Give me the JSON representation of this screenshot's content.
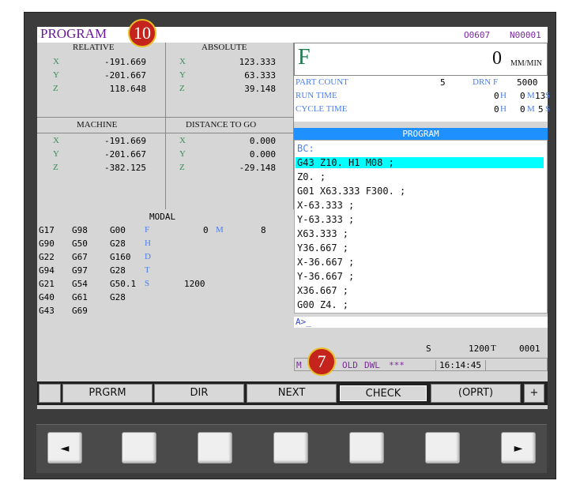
{
  "header": {
    "title": "PROGRAM",
    "program_no": "O0607",
    "sequence_no": "N00001"
  },
  "badges": {
    "top": "10",
    "bottom": "7"
  },
  "relative": {
    "title": "RELATIVE",
    "rows": [
      {
        "axis": "X",
        "value": "-191.669"
      },
      {
        "axis": "Y",
        "value": "-201.667"
      },
      {
        "axis": "Z",
        "value": "118.648"
      }
    ]
  },
  "absolute": {
    "title": "ABSOLUTE",
    "rows": [
      {
        "axis": "X",
        "value": "123.333"
      },
      {
        "axis": "Y",
        "value": "63.333"
      },
      {
        "axis": "Z",
        "value": "39.148"
      }
    ]
  },
  "machine": {
    "title": "MACHINE",
    "rows": [
      {
        "axis": "X",
        "value": "-191.669"
      },
      {
        "axis": "Y",
        "value": "-201.667"
      },
      {
        "axis": "Z",
        "value": "-382.125"
      }
    ]
  },
  "distance": {
    "title": "DISTANCE TO GO",
    "rows": [
      {
        "axis": "X",
        "value": "0.000"
      },
      {
        "axis": "Y",
        "value": "0.000"
      },
      {
        "axis": "Z",
        "value": "-29.148"
      }
    ]
  },
  "modal": {
    "title": "MODAL",
    "rows": [
      [
        "G17",
        "G98",
        "G00"
      ],
      [
        "G90",
        "G50",
        "G28"
      ],
      [
        "G22",
        "G67",
        "G160"
      ],
      [
        "G94",
        "G97",
        "G28"
      ],
      [
        "G21",
        "G54",
        "G50.1"
      ],
      [
        "G40",
        "G61",
        "G28"
      ],
      [
        "G43",
        "G69",
        ""
      ]
    ],
    "f_label": "F",
    "f_value": "0",
    "m_label": "M",
    "m_value": "8",
    "h_label": "H",
    "d_label": "D",
    "t_label": "T",
    "s_label": "S",
    "s_value": "1200"
  },
  "feed": {
    "label": "F",
    "value": "0",
    "unit": "MM/MIN"
  },
  "status": {
    "part_count_label": "PART COUNT",
    "part_count": "5",
    "drnf_label": "DRN F",
    "drnf_value": "5000",
    "run_time_label": "RUN TIME",
    "run_h": "0",
    "run_m": "0",
    "run_s": "13",
    "cycle_time_label": "CYCLE TIME",
    "cycle_h": "0",
    "cycle_m": "0",
    "cycle_s": "5",
    "h_unit": "H",
    "m_unit": "M",
    "s_unit": "S"
  },
  "program": {
    "title": "PROGRAM",
    "lines": [
      "BC:",
      "G43 Z10. H1 M08 ;",
      "Z0. ;",
      "G01 X63.333 F300. ;",
      "X-63.333 ;",
      "Y-63.333 ;",
      "X63.333 ;",
      "Y36.667 ;",
      "X-36.667 ;",
      "Y-36.667 ;",
      "X36.667 ;",
      "G00 Z4. ;"
    ]
  },
  "input_prompt": "A>_",
  "bottom_status": {
    "s_label": "S",
    "s_value": "1200",
    "t_label": "T",
    "t_value": "0001",
    "mode_prefix": "M",
    "mode": "OLD",
    "dwl": "DWL",
    "stars": "***",
    "time": "16:14:45"
  },
  "softkeys": {
    "k1": "PRGRM",
    "k2": "DIR",
    "k3": "NEXT",
    "k4": "CHECK",
    "k5": "(OPRT)",
    "k6": "+"
  },
  "hw_buttons": {
    "left": "◄",
    "right": "►"
  }
}
